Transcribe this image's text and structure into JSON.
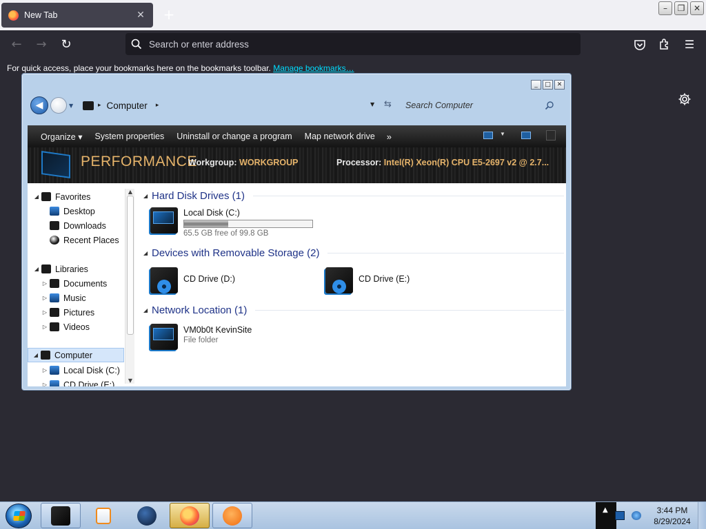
{
  "browser": {
    "tab": {
      "title": "New Tab",
      "close": "✕"
    },
    "new_tab": "+",
    "window_controls": [
      "–",
      "❐",
      "✕"
    ],
    "nav": {
      "back": "←",
      "forward": "→",
      "reload": "↻"
    },
    "address_placeholder": "Search or enter address",
    "bookmarks_text": "For quick access, place your bookmarks here on the bookmarks toolbar.",
    "bookmarks_link": "Manage bookmarks…",
    "toolbar_icons": [
      "pocket-icon",
      "extensions-icon",
      "menu-icon"
    ],
    "menu_glyph": "☰",
    "accent_link_color": "#00ddff"
  },
  "explorer": {
    "controls": [
      "_",
      "□",
      "✕"
    ],
    "nav": {
      "back": "◀"
    },
    "breadcrumb": {
      "label": "Computer",
      "sep": "▸"
    },
    "search_placeholder": "Search Computer",
    "commands": [
      "Organize ▾",
      "System properties",
      "Uninstall or change a program",
      "Map network drive"
    ],
    "more": "»",
    "details": {
      "title": "PERFORMANCE",
      "workgroup_label": "Workgroup:",
      "workgroup_value": "WORKGROUP",
      "processor_label": "Processor:",
      "processor_value": "Intel(R) Xeon(R) CPU E5-2697 v2 @ 2.7..."
    },
    "nav_pane": [
      {
        "label": "Favorites",
        "twisty": "◢",
        "indent": 0
      },
      {
        "label": "Desktop",
        "twisty": "",
        "indent": 1
      },
      {
        "label": "Downloads",
        "twisty": "",
        "indent": 1
      },
      {
        "label": "Recent Places",
        "twisty": "",
        "indent": 1
      },
      {
        "label": "Libraries",
        "twisty": "◢",
        "indent": 0
      },
      {
        "label": "Documents",
        "twisty": "▷",
        "indent": 1
      },
      {
        "label": "Music",
        "twisty": "▷",
        "indent": 1
      },
      {
        "label": "Pictures",
        "twisty": "▷",
        "indent": 1
      },
      {
        "label": "Videos",
        "twisty": "▷",
        "indent": 1
      },
      {
        "label": "Computer",
        "twisty": "◢",
        "indent": 0,
        "selected": true
      },
      {
        "label": "Local Disk (C:)",
        "twisty": "▷",
        "indent": 1
      },
      {
        "label": "CD Drive (E:)",
        "twisty": "▷",
        "indent": 1
      }
    ],
    "groups": {
      "hdd": {
        "title": "Hard Disk Drives (1)",
        "twisty": "◢"
      },
      "removable": {
        "title": "Devices with Removable Storage (2)",
        "twisty": "◢"
      },
      "network": {
        "title": "Network Location (1)",
        "twisty": "◢"
      }
    },
    "local_disk": {
      "name": "Local Disk (C:)",
      "free_text": "65.5 GB free of 99.8 GB",
      "used_fraction": 0.344
    },
    "cd_d": {
      "name": "CD Drive (D:)"
    },
    "cd_e": {
      "name": "CD Drive (E:)"
    },
    "network_item": {
      "name": "VM0b0t KevinSite",
      "type": "File folder"
    }
  },
  "taskbar": {
    "buttons": [
      "explorer-app-icon",
      "media-player-icon",
      "globe-icon",
      "firefox-icon",
      "avast-icon"
    ],
    "time": "3:44 PM",
    "date": "8/29/2024"
  }
}
